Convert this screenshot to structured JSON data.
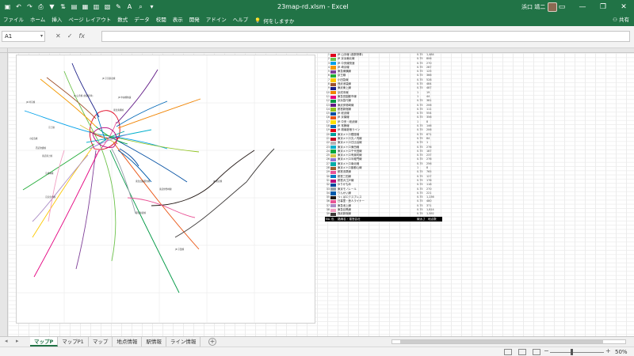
{
  "window": {
    "title": "23map-rd.xlsm  -  Excel",
    "user": "浜口 靖二"
  },
  "ribbon": {
    "tabs": [
      "ファイル",
      "ホーム",
      "挿入",
      "ページ レイアウト",
      "数式",
      "データ",
      "校閲",
      "表示",
      "開発",
      "アドイン",
      "ヘルプ"
    ],
    "tell_me": "何をしますか",
    "share": "共有"
  },
  "formula_bar": {
    "name_box": "A1",
    "fx": "fx",
    "value": ""
  },
  "map_labels": [
    "JR 山手線 (各駅停車)",
    "JR 京浜東北線",
    "JR 中央線快速",
    "JR 埼京線",
    "東急東横線",
    "京王線",
    "小田急線",
    "西武池袋線",
    "東武東上線",
    "京成本線",
    "東急田園都市線",
    "京浜急行線",
    "東武伊勢崎線",
    "都営新宿線",
    "JR 総武線",
    "JR 京葉線"
  ],
  "table_header": {
    "no": "No.",
    "color": "色",
    "name": "路線名・運営会社",
    "width": "線太さ",
    "count": "地点数"
  },
  "table_rows": [
    {
      "no": "1",
      "name": "JR 山手線 (各駅停車)",
      "val": "0.75",
      "cnt": "1,484",
      "color": "#e0001c"
    },
    {
      "no": "2",
      "name": "JR 京浜東北線",
      "val": "0.75",
      "cnt": "806",
      "color": "#6cc24a"
    },
    {
      "no": "3",
      "name": "JR 中央線快速",
      "val": "0.75",
      "cnt": "270",
      "color": "#00a0e9"
    },
    {
      "no": "4",
      "name": "JR 埼京線",
      "val": "0.75",
      "cnt": "287",
      "color": "#f39800"
    },
    {
      "no": "5",
      "name": "東急東横線",
      "val": "0.75",
      "cnt": "125",
      "color": "#7f3f98"
    },
    {
      "no": "6",
      "name": "京王線",
      "val": "0.75",
      "cnt": "366",
      "color": "#22ac38"
    },
    {
      "no": "7",
      "name": "小田急線",
      "val": "0.75",
      "cnt": "528",
      "color": "#fcc800"
    },
    {
      "no": "8",
      "name": "西武池袋線",
      "val": "0.75",
      "cnt": "484",
      "color": "#a0522d"
    },
    {
      "no": "9",
      "name": "東武東上線",
      "val": "0.75",
      "cnt": "487",
      "color": "#1d2088"
    },
    {
      "no": "10",
      "name": "京成本線",
      "val": "1",
      "cnt": "19",
      "color": "#f08300"
    },
    {
      "no": "11",
      "name": "東急田園都市線",
      "val": "1",
      "cnt": "44",
      "color": "#e4007f"
    },
    {
      "no": "12",
      "name": "京浜急行線",
      "val": "0.75",
      "cnt": "381",
      "color": "#009944"
    },
    {
      "no": "13",
      "name": "東武伊勢崎線",
      "val": "0.75",
      "cnt": "206",
      "color": "#601986"
    },
    {
      "no": "14",
      "name": "都営新宿線",
      "val": "0.75",
      "cnt": "111",
      "color": "#8fc31f"
    },
    {
      "no": "15",
      "name": "JR 総武線",
      "val": "0.75",
      "cnt": "554",
      "color": "#004ea2"
    },
    {
      "no": "16",
      "name": "JR 京葉線",
      "val": "0.75",
      "cnt": "356",
      "color": "#ea5514"
    },
    {
      "no": "17",
      "name": "JR 中央・総武線",
      "val": "1",
      "cnt": "8",
      "color": "#ffe100"
    },
    {
      "no": "18",
      "name": "JR 常磐線",
      "val": "0.75",
      "cnt": "146",
      "color": "#0068b7"
    },
    {
      "no": "19",
      "name": "JR 湘南新宿ライン",
      "val": "0.75",
      "cnt": "206",
      "color": "#e60012"
    },
    {
      "no": "20",
      "name": "東京メトロ銀座線",
      "val": "0.75",
      "cnt": "671",
      "color": "#00a29a"
    },
    {
      "no": "21",
      "name": "東京メトロ丸ノ内線",
      "val": "0.75",
      "cnt": "84",
      "color": "#c30d23"
    },
    {
      "no": "22",
      "name": "東京メトロ日比谷線",
      "val": "0.75",
      "cnt": "1",
      "color": "#b5b5b6"
    },
    {
      "no": "23",
      "name": "東京メトロ東西線",
      "val": "0.75",
      "cnt": "276",
      "color": "#00afcc"
    },
    {
      "no": "24",
      "name": "東京メトロ千代田線",
      "val": "0.75",
      "cnt": "187",
      "color": "#00a73c"
    },
    {
      "no": "25",
      "name": "東京メトロ有楽町線",
      "val": "0.75",
      "cnt": "237",
      "color": "#d7c447"
    },
    {
      "no": "26",
      "name": "東京メトロ半蔵門線",
      "val": "0.75",
      "cnt": "276",
      "color": "#8f76d6"
    },
    {
      "no": "27",
      "name": "東京メトロ南北線",
      "val": "0.75",
      "cnt": "256",
      "color": "#00ada9"
    },
    {
      "no": "28",
      "name": "東京メトロ副都心線",
      "val": "1",
      "cnt": "8",
      "color": "#9c5e31"
    },
    {
      "no": "29",
      "name": "都営浅草線",
      "val": "0.75",
      "cnt": "765",
      "color": "#e85298"
    },
    {
      "no": "30",
      "name": "都営三田線",
      "val": "0.75",
      "cnt": "127",
      "color": "#0079c2"
    },
    {
      "no": "31",
      "name": "都営大江戸線",
      "val": "0.75",
      "cnt": "176",
      "color": "#b6007a"
    },
    {
      "no": "32",
      "name": "ゆりかもめ",
      "val": "0.75",
      "cnt": "118",
      "color": "#00479d"
    },
    {
      "no": "33",
      "name": "東京モノレール",
      "val": "0.75",
      "cnt": "270",
      "color": "#95a0a9"
    },
    {
      "no": "34",
      "name": "りんかい線",
      "val": "0.75",
      "cnt": "221",
      "color": "#005aab"
    },
    {
      "no": "35",
      "name": "つくばエクスプレス",
      "val": "0.75",
      "cnt": "1,236",
      "color": "#231815"
    },
    {
      "no": "36",
      "name": "日暮里・舎人ライナー",
      "val": "0.75",
      "cnt": "480",
      "color": "#e95295"
    },
    {
      "no": "37",
      "name": "東急池上線",
      "val": "0.75",
      "cnt": "371",
      "color": "#aa8cc5"
    },
    {
      "no": "38",
      "name": "東急目黒線",
      "val": "0.75",
      "cnt": "1,814",
      "color": "#f19ec2"
    },
    {
      "no": "39",
      "name": "西武新宿線",
      "val": "0.75",
      "cnt": "1,592",
      "color": "#3e3a39"
    }
  ],
  "sheet_tabs": [
    "マップP",
    "マップP1",
    "マップ",
    "地点情報",
    "駅情報",
    "ライン情報"
  ],
  "active_sheet": "マップP",
  "zoom": "50%"
}
